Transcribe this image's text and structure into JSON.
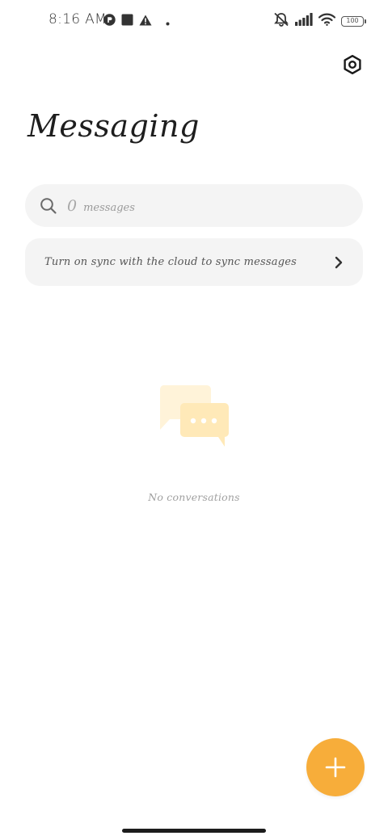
{
  "status_bar": {
    "time": "8:16 AM",
    "battery": "100",
    "left_icons": [
      "r-badge-icon",
      "square-icon",
      "warning-icon",
      "dot-icon"
    ],
    "right_icons": [
      "mute-icon",
      "signal-icon",
      "wifi-icon",
      "battery-icon"
    ]
  },
  "header": {
    "title": "Messaging",
    "settings_icon": "gear-icon"
  },
  "search": {
    "count": "0",
    "placeholder": "messages"
  },
  "sync": {
    "label": "Turn on sync with the cloud to sync messages"
  },
  "empty_state": {
    "message": "No conversations"
  },
  "colors": {
    "accent": "#f7ad3a",
    "surface": "#f4f4f4",
    "illustration_light": "#fff3d9",
    "illustration_main": "#ffe9b8"
  }
}
